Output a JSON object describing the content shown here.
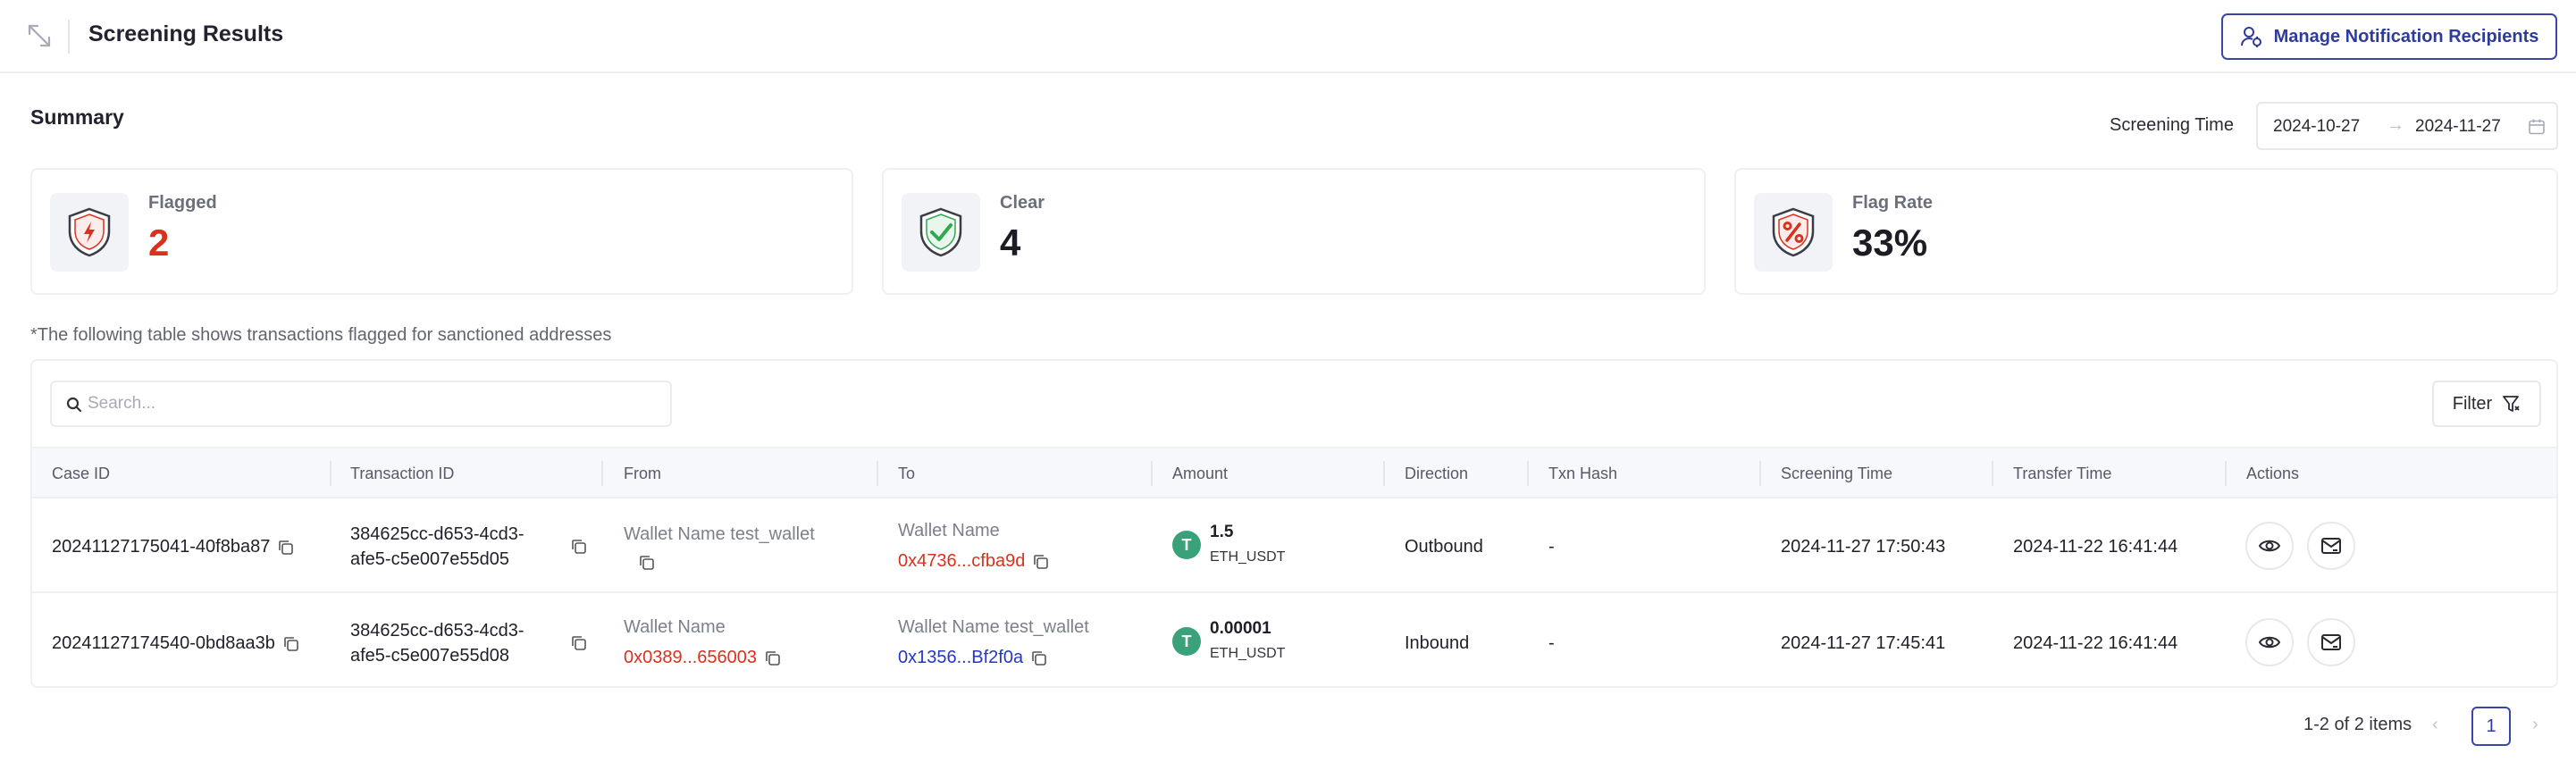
{
  "header": {
    "title": "Screening Results",
    "manage_button": "Manage Notification Recipients"
  },
  "summary": {
    "title": "Summary",
    "screening_time_label": "Screening Time",
    "date_from": "2024-10-27",
    "date_arrow": "→",
    "date_to": "2024-11-27",
    "cards": [
      {
        "label": "Flagged",
        "value": "2",
        "icon": "shield-bolt-icon",
        "color": "#d8321f"
      },
      {
        "label": "Clear",
        "value": "4",
        "icon": "shield-check-icon",
        "color": "#2fa84f"
      },
      {
        "label": "Flag Rate",
        "value": "33%",
        "icon": "shield-percent-icon",
        "color": "#d8321f"
      }
    ]
  },
  "note": "*The following table shows transactions flagged for sanctioned addresses",
  "search": {
    "placeholder": "Search..."
  },
  "filter_label": "Filter",
  "columns": [
    "Case ID",
    "Transaction ID",
    "From",
    "To",
    "Amount",
    "Direction",
    "Txn Hash",
    "Screening Time",
    "Transfer Time",
    "Actions"
  ],
  "rows": [
    {
      "case_id": "20241127175041-40f8ba87",
      "txn_id_1": "384625cc-d653-4cd3-",
      "txn_id_2": "afe5-c5e007e55d05",
      "from_name": "Wallet Name test_wallet",
      "from_addr": "",
      "to_name": "Wallet Name",
      "to_addr": "0x4736...cfba9d",
      "token_symbol": "T",
      "amount": "1.5",
      "token": "ETH_USDT",
      "direction": "Outbound",
      "txn_hash": "-",
      "screening_time": "2024-11-27 17:50:43",
      "transfer_time": "2024-11-22 16:41:44"
    },
    {
      "case_id": "20241127174540-0bd8aa3b",
      "txn_id_1": "384625cc-d653-4cd3-",
      "txn_id_2": "afe5-c5e007e55d08",
      "from_name": "Wallet Name",
      "from_addr": "0x0389...656003",
      "to_name": "Wallet Name test_wallet",
      "to_addr": "0x1356...Bf2f0a",
      "token_symbol": "T",
      "amount": "0.00001",
      "token": "ETH_USDT",
      "direction": "Inbound",
      "txn_hash": "-",
      "screening_time": "2024-11-27 17:45:41",
      "transfer_time": "2024-11-22 16:41:44"
    }
  ],
  "pagination": {
    "summary": "1-2 of 2 items",
    "prev": "‹",
    "current": "1",
    "next": "›"
  }
}
